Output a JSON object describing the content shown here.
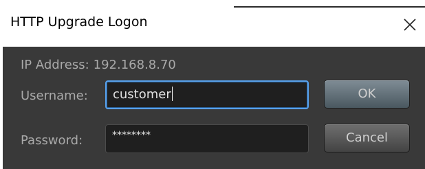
{
  "window": {
    "title": "HTTP Upgrade Logon",
    "close_icon": "close-icon"
  },
  "form": {
    "ip_label": "IP Address:",
    "ip_value": "192.168.8.70",
    "username_label": "Username:",
    "username_value": "customer",
    "password_label": "Password:",
    "password_value": "********"
  },
  "buttons": {
    "ok_label": "OK",
    "cancel_label": "Cancel"
  },
  "colors": {
    "panel": "#393939",
    "focus_border": "#58a0ea"
  }
}
